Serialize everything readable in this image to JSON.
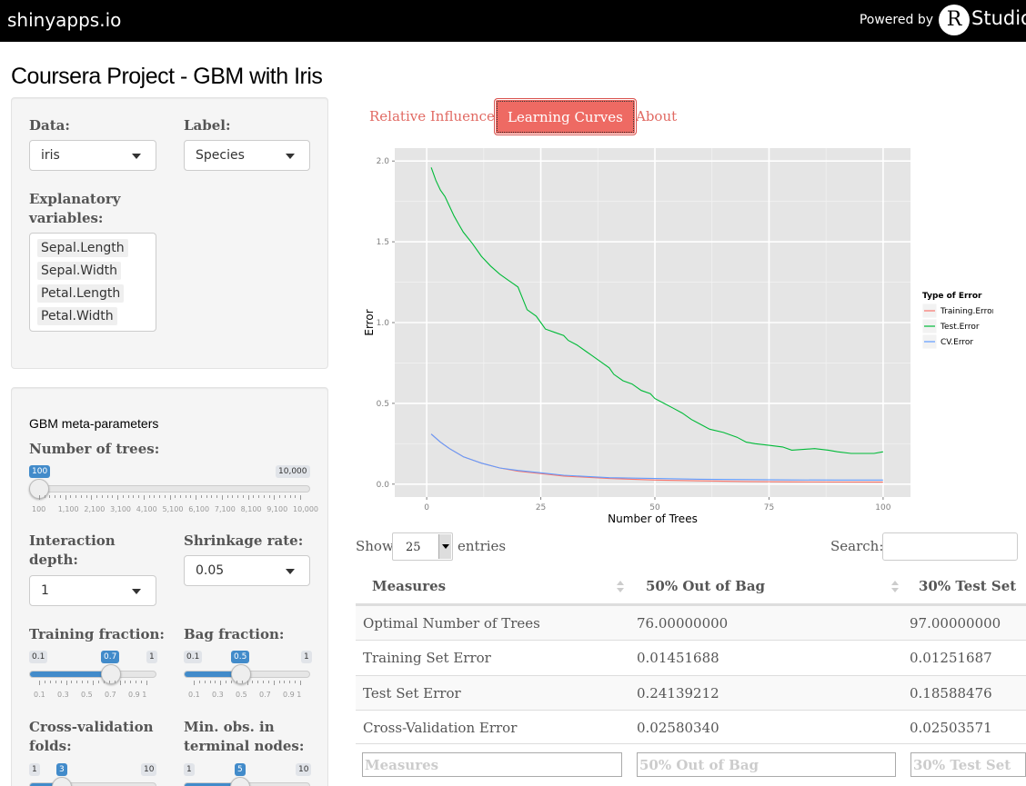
{
  "topbar": {
    "brand": "shinyapps.io",
    "powered_by": "Powered by",
    "r_letter": "R",
    "studio": "Studio"
  },
  "page_title": "Coursera Project - GBM with Iris",
  "sidebar": {
    "data_label": "Data:",
    "data_value": "iris",
    "label_label": "Label:",
    "label_value": "Species",
    "explanatory_label": "Explanatory variables:",
    "explanatory_items": [
      "Sepal.Length",
      "Sepal.Width",
      "Petal.Length",
      "Petal.Width"
    ],
    "meta_heading": "GBM meta-parameters",
    "num_trees": {
      "label": "Number of trees:",
      "value": "100",
      "max": "10,000",
      "fraction": 0,
      "grid": [
        "100",
        "1,100",
        "2,100",
        "3,100",
        "4,100",
        "5,100",
        "6,100",
        "7,100",
        "8,100",
        "9,100",
        "10,000"
      ]
    },
    "interaction_label": "Interaction depth:",
    "interaction_value": "1",
    "shrinkage_label": "Shrinkage rate:",
    "shrinkage_value": "0.05",
    "training_fraction": {
      "label": "Training fraction:",
      "min": "0.1",
      "value": "0.7",
      "max": "1",
      "fraction": 0.667,
      "grid": [
        "0.1",
        "0.3",
        "0.5",
        "0.7",
        "0.9 1"
      ]
    },
    "bag_fraction": {
      "label": "Bag fraction:",
      "min": "0.1",
      "value": "0.5",
      "max": "1",
      "fraction": 0.444,
      "grid": [
        "0.1",
        "0.3",
        "0.5",
        "0.7",
        "0.9 1"
      ]
    },
    "cv_folds": {
      "label": "Cross-validation folds:",
      "min": "1",
      "value": "3",
      "max": "10"
    },
    "min_obs": {
      "label": "Min. obs. in terminal nodes:",
      "min": "1",
      "value": "5",
      "max": "10"
    }
  },
  "tabs": [
    "Relative Influence",
    "Learning Curves",
    "About"
  ],
  "active_tab": 1,
  "colors": {
    "training": "#f8766d",
    "test": "#00ba38",
    "cv": "#619cff",
    "tab_active": "#ee6a63"
  },
  "chart_data": {
    "type": "line",
    "xlabel": "Number of Trees",
    "ylabel": "Error",
    "xlim": [
      -7,
      106
    ],
    "ylim": [
      -0.08,
      2.08
    ],
    "xticks": [
      0,
      25,
      50,
      75,
      100
    ],
    "yticks": [
      "0.0",
      "0.5",
      "1.0",
      "1.5",
      "2.0"
    ],
    "grid": true,
    "legend_title": "Type of Error",
    "legend_position": "right",
    "series": [
      {
        "name": "Training.Error",
        "x": [
          1,
          3,
          5,
          8,
          12,
          16,
          20,
          25,
          30,
          40,
          50,
          60,
          70,
          80,
          90,
          100
        ],
        "y": [
          0.31,
          0.26,
          0.22,
          0.17,
          0.13,
          0.1,
          0.08,
          0.065,
          0.05,
          0.035,
          0.025,
          0.02,
          0.016,
          0.014,
          0.013,
          0.0125
        ]
      },
      {
        "name": "Test.Error",
        "x": [
          1,
          2,
          3,
          4,
          5,
          6,
          7,
          8,
          10,
          12,
          14,
          16,
          18,
          19,
          20,
          21,
          22,
          24,
          25,
          26,
          28,
          30,
          31,
          33,
          35,
          36,
          38,
          40,
          41,
          43,
          45,
          47,
          49,
          50,
          52,
          54,
          56,
          58,
          60,
          62,
          65,
          68,
          70,
          72,
          75,
          78,
          80,
          85,
          88,
          90,
          93,
          95,
          98,
          100
        ],
        "y": [
          1.96,
          1.88,
          1.82,
          1.78,
          1.72,
          1.66,
          1.61,
          1.56,
          1.49,
          1.41,
          1.35,
          1.3,
          1.26,
          1.24,
          1.22,
          1.15,
          1.08,
          1.04,
          1.0,
          0.96,
          0.94,
          0.92,
          0.89,
          0.86,
          0.82,
          0.8,
          0.76,
          0.72,
          0.68,
          0.64,
          0.62,
          0.58,
          0.56,
          0.53,
          0.5,
          0.47,
          0.44,
          0.4,
          0.37,
          0.34,
          0.32,
          0.29,
          0.26,
          0.25,
          0.24,
          0.23,
          0.21,
          0.22,
          0.21,
          0.2,
          0.19,
          0.19,
          0.19,
          0.2
        ]
      },
      {
        "name": "CV.Error",
        "x": [
          1,
          3,
          5,
          8,
          12,
          16,
          20,
          25,
          30,
          40,
          50,
          60,
          70,
          80,
          90,
          100
        ],
        "y": [
          0.31,
          0.26,
          0.22,
          0.17,
          0.13,
          0.1,
          0.085,
          0.07,
          0.055,
          0.04,
          0.035,
          0.03,
          0.028,
          0.026,
          0.025,
          0.025
        ]
      }
    ]
  },
  "table": {
    "show_label": "Show",
    "length_value": "25",
    "entries_label": "entries",
    "search_label": "Search:",
    "headers": [
      "Measures",
      "50% Out of Bag",
      "30% Test Set"
    ],
    "rows": [
      [
        "Optimal Number of Trees",
        "76.00000000",
        "97.00000000"
      ],
      [
        "Training Set Error",
        "0.01451688",
        "0.01251687"
      ],
      [
        "Test Set Error",
        "0.24139212",
        "0.18588476"
      ],
      [
        "Cross-Validation Error",
        "0.02580340",
        "0.02503571"
      ]
    ],
    "footer_placeholders": [
      "Measures",
      "50% Out of Bag",
      "30% Test Set"
    ]
  }
}
